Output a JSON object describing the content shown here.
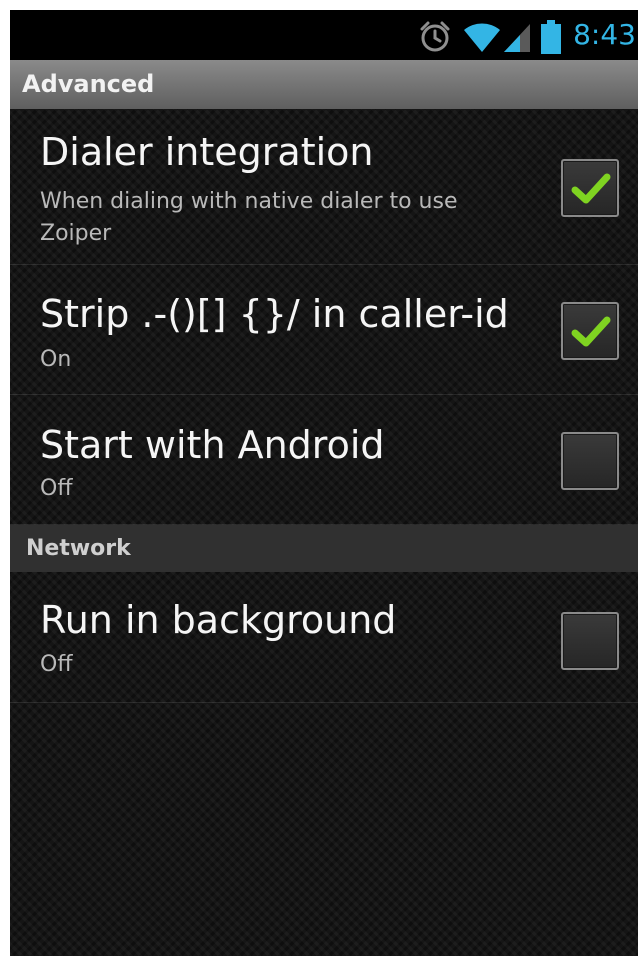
{
  "status_bar": {
    "time": "8:43",
    "icons": [
      "alarm-icon",
      "wifi-icon",
      "signal-icon",
      "battery-icon"
    ],
    "accent_color": "#33b5e5"
  },
  "sections": {
    "advanced": "Advanced",
    "network": "Network"
  },
  "preferences": [
    {
      "title": "Dialer integration",
      "summary": "When dialing with native dialer to use Zoiper",
      "checked": true
    },
    {
      "title": "Strip .-()[] {}/ in caller-id",
      "summary": "On",
      "checked": true
    },
    {
      "title": "Start with Android",
      "summary": "Off",
      "checked": false
    },
    {
      "title": "Run in background",
      "summary": "Off",
      "checked": false
    }
  ],
  "colors": {
    "check_mark": "#7fd321",
    "text_primary": "#f5f5f5",
    "text_secondary": "#b9b9b9"
  }
}
